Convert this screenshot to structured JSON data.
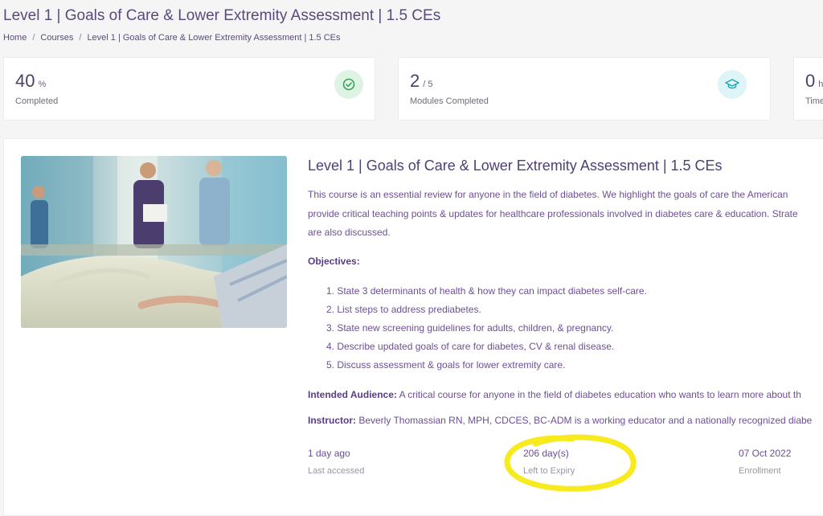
{
  "page": {
    "title": "Level 1 | Goals of Care & Lower Extremity Assessment | 1.5 CEs",
    "breadcrumb": [
      "Home",
      "Courses",
      "Level 1 | Goals of Care & Lower Extremity Assessment | 1.5 CEs"
    ]
  },
  "stats": [
    {
      "value": "40",
      "unit": "%",
      "label": "Completed",
      "icon": "check-circle-icon",
      "icon_color": "#3aa15c",
      "icon_bg": "#dff3e4"
    },
    {
      "value": "2",
      "unit": "/ 5",
      "label": "Modules Completed",
      "icon": "graduation-cap-icon",
      "icon_color": "#1da6b8",
      "icon_bg": "#dff4f7"
    },
    {
      "value": "0",
      "unit": "h",
      "label": "Time"
    }
  ],
  "course": {
    "title": "Level 1 | Goals of Care & Lower Extremity Assessment | 1.5 CEs",
    "description_lines": [
      "This course is an essential review for anyone in the field of diabetes. We highlight the goals of care the American",
      "provide critical teaching points & updates for healthcare professionals involved in diabetes care & education. Strate",
      "are also discussed."
    ],
    "objectives_heading": "Objectives:",
    "objectives": [
      "1. State 3 determinants of health & how they can impact diabetes self-care.",
      "2. List steps to address prediabetes.",
      "3. State new screening guidelines for adults, children, & pregnancy.",
      "4. Describe updated goals of care for diabetes, CV & renal disease.",
      "5. Discuss assessment & goals for lower extremity care."
    ],
    "audience_label": "Intended Audience:",
    "audience_text": " A critical course for anyone in the field of diabetes education who wants to learn more about th",
    "instructor_label": "Instructor:",
    "instructor_text": " Beverly Thomassian RN, MPH, CDCES, BC-ADM is a working educator and a nationally recognized diabe",
    "meta": [
      {
        "value": "1 day ago",
        "label": "Last accessed"
      },
      {
        "value": "206 day(s)",
        "label": "Left to Expiry"
      },
      {
        "value": "07 Oct 2022",
        "label": "Enrollment"
      }
    ]
  },
  "colors": {
    "accent": "#5a4a7a",
    "highlight": "#f7ea1e"
  }
}
